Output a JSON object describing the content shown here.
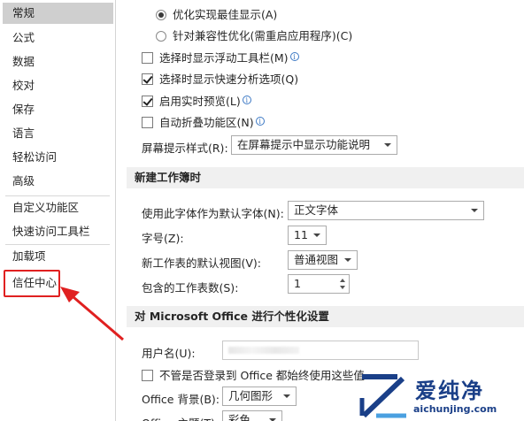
{
  "nav": {
    "items": [
      "常规",
      "公式",
      "数据",
      "校对",
      "保存",
      "语言",
      "轻松访问",
      "高级",
      "自定义功能区",
      "快速访问工具栏",
      "加载项",
      "信任中心"
    ],
    "selected": "常规",
    "highlighted": "信任中心"
  },
  "ui_options": {
    "radio_optimize_display": "优化实现最佳显示(A)",
    "radio_compat": "针对兼容性优化(需重启应用程序)(C)",
    "show_mini_toolbar": "选择时显示浮动工具栏(M)",
    "show_quick_analysis": "选择时显示快速分析选项(Q)",
    "live_preview": "启用实时预览(L)",
    "collapse_ribbon": "自动折叠功能区(N)",
    "screentip_label": "屏幕提示样式(R):",
    "screentip_value": "在屏幕提示中显示功能说明"
  },
  "new_workbook": {
    "section_title": "新建工作簿时",
    "font_label": "使用此字体作为默认字体(N):",
    "font_value": "正文字体",
    "size_label": "字号(Z):",
    "size_value": "11",
    "view_label": "新工作表的默认视图(V):",
    "view_value": "普通视图",
    "sheets_label": "包含的工作表数(S):",
    "sheets_value": "1"
  },
  "personalize": {
    "section_title": "对 Microsoft Office 进行个性化设置",
    "username_label": "用户名(U):",
    "always_use_label": "不管是否登录到 Office 都始终使用这些值",
    "background_label": "Office 背景(B):",
    "background_value": "几何图形",
    "theme_label": "Office 主题(T):",
    "theme_value": "彩色"
  },
  "watermark": {
    "text": "爱纯净",
    "url": "aichunjing.com"
  },
  "colors": {
    "highlight_red": "#e02020",
    "nav_selected": "#cfcfcf",
    "section_bg": "#f0f0f0",
    "info_blue": "#3c78c4"
  }
}
